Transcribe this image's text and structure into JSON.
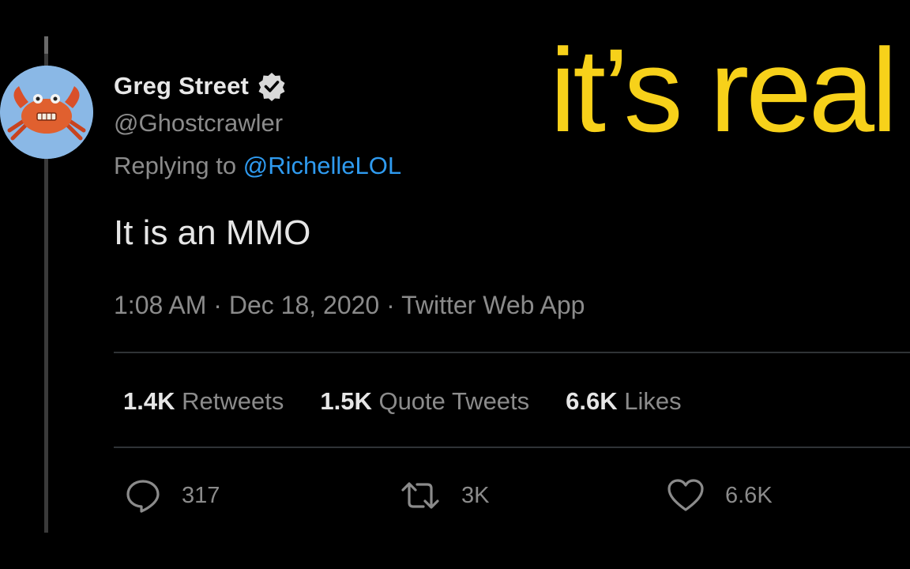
{
  "tweet": {
    "display_name": "Greg Street",
    "handle": "@Ghostcrawler",
    "replying_prefix": "Replying to",
    "replying_to": "@RichelleLOL",
    "text": "It is an MMO",
    "time": "1:08 AM",
    "date": "Dec 18, 2020",
    "source": "Twitter Web App",
    "separator": "·"
  },
  "stats": {
    "retweets_count": "1.4K",
    "retweets_label": "Retweets",
    "quotes_count": "1.5K",
    "quotes_label": "Quote Tweets",
    "likes_count": "6.6K",
    "likes_label": "Likes"
  },
  "actions": {
    "reply_count": "317",
    "retweet_count": "3K",
    "like_count": "6.6K"
  },
  "overlay": {
    "caption": "it’s real"
  },
  "colors": {
    "background": "#000000",
    "mention": "#2f9bf0",
    "caption": "#f7d11a",
    "avatar_bg": "#8ab8e6"
  },
  "icons": [
    "verified-badge-icon",
    "reply-icon",
    "retweet-icon",
    "like-icon"
  ]
}
